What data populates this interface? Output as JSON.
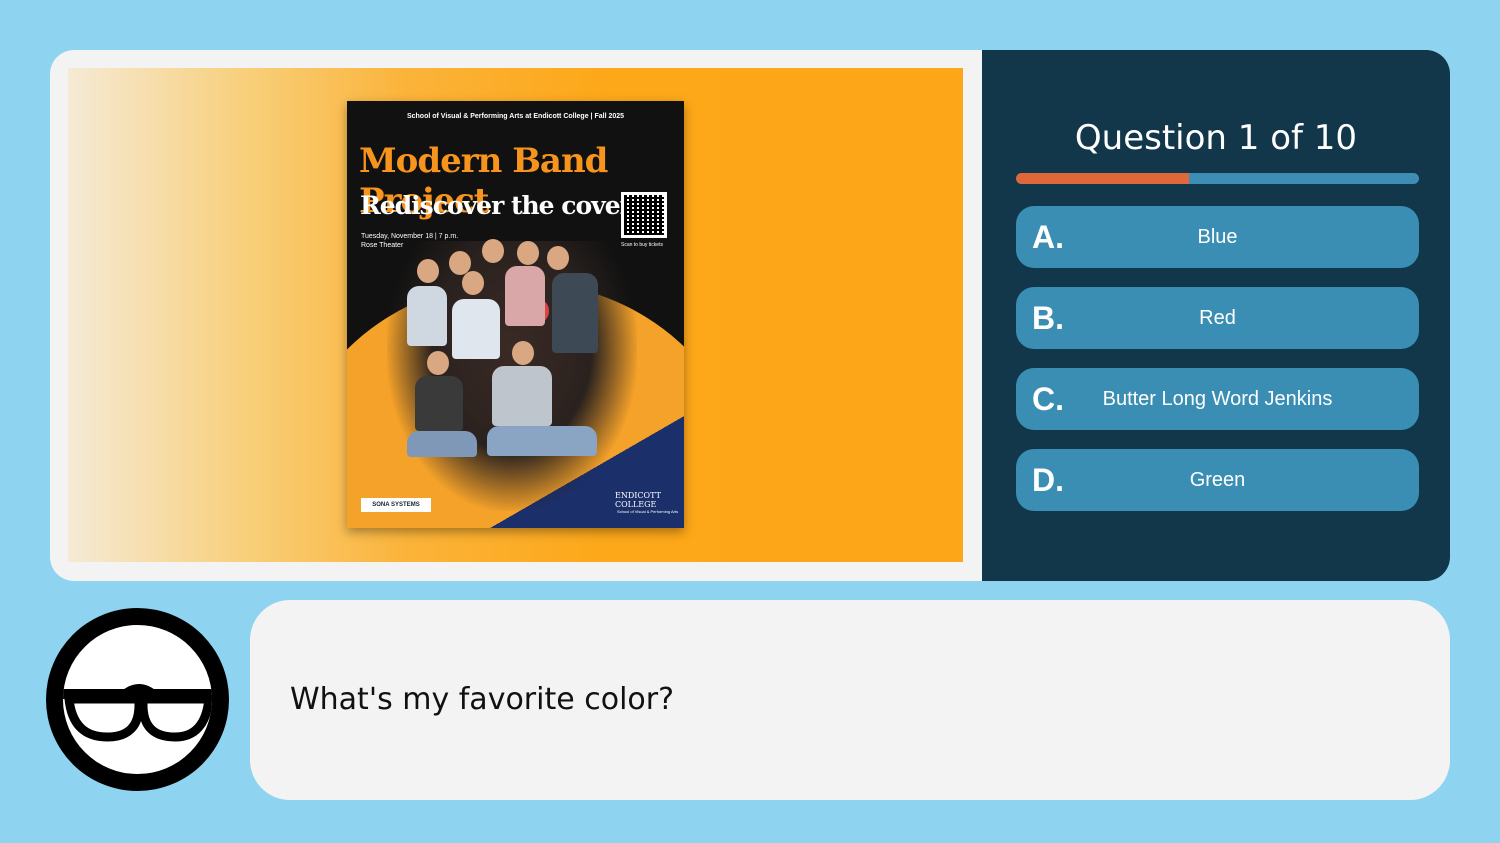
{
  "quiz": {
    "title": "Question 1 of 10",
    "progress_fraction": 0.43,
    "options": [
      {
        "letter": "A.",
        "text": "Blue"
      },
      {
        "letter": "B.",
        "text": "Red"
      },
      {
        "letter": "C.",
        "text": "Butter Long Word Jenkins"
      },
      {
        "letter": "D.",
        "text": "Green"
      }
    ]
  },
  "poster": {
    "top_line": "School of Visual & Performing Arts at Endicott College | Fall 2025",
    "title": "Modern Band Project",
    "subtitle": "Rediscover the cover",
    "date_line": "Tuesday, November 18 | 7 p.m.",
    "venue_line": "Rose Theater",
    "scan_text": "Scan to buy tickets",
    "sponsor_logo": "SONA SYSTEMS",
    "college_logo": "ENDICOTT COLLEGE",
    "college_small": "School of Visual & Performing Arts"
  },
  "speech": {
    "text": "What's my favorite color?"
  },
  "colors": {
    "background": "#8ed4f0",
    "quiz_panel": "#12364a",
    "option_bg": "#3a8eb4",
    "progress_fill": "#e0673a",
    "progress_track": "#3d8db5"
  },
  "icons": {
    "avatar": "glasses-face-icon",
    "qr": "qr-code-icon"
  }
}
